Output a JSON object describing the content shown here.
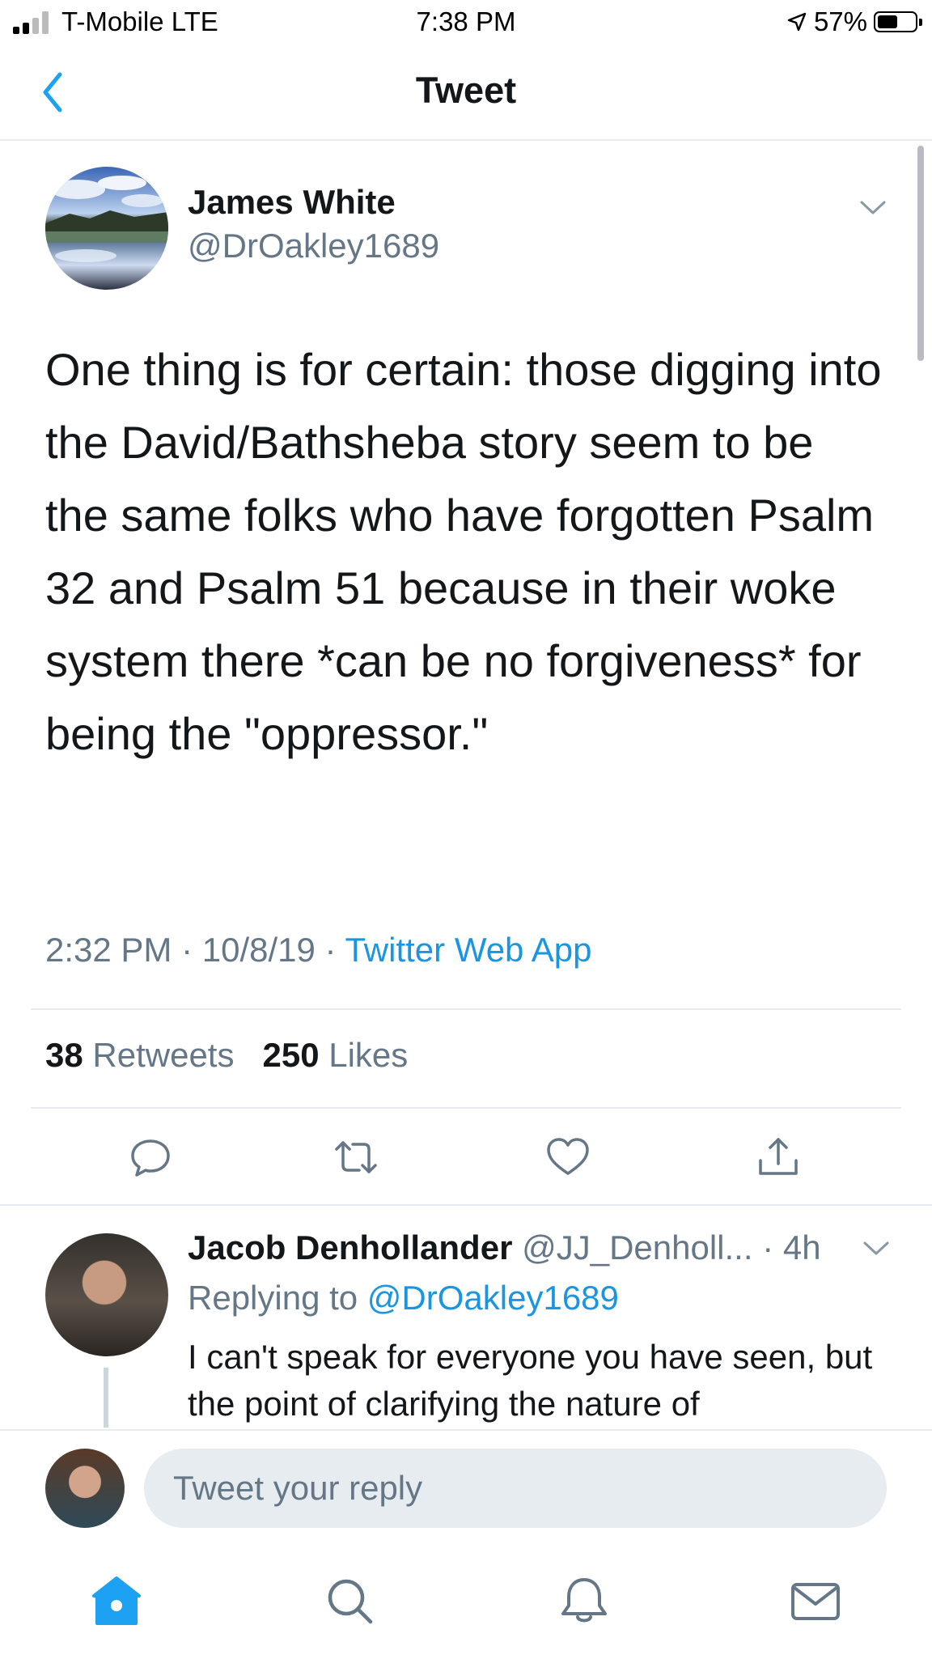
{
  "status_bar": {
    "carrier": "T-Mobile LTE",
    "time": "7:38 PM",
    "battery": "57%",
    "battery_level": 0.57
  },
  "header": {
    "title": "Tweet",
    "back_icon": "chevron-left-icon"
  },
  "tweet": {
    "author_name": "James White",
    "author_handle": "@DrOakley1689",
    "text": "One thing is for certain: those digging into the David/Bathsheba story seem to be the same folks who have forgotten Psalm 32 and Psalm 51 because in their woke system there *can be no forgiveness* for being the \"oppressor.\"",
    "time": "2:32 PM",
    "date": "10/8/19",
    "source": "Twitter Web App",
    "retweets_count": "38",
    "retweets_label": "Retweets",
    "likes_count": "250",
    "likes_label": "Likes",
    "actions": [
      "reply-icon",
      "retweet-icon",
      "like-icon",
      "share-icon"
    ]
  },
  "reply": {
    "author_name": "Jacob Denhollander",
    "author_handle": "@JJ_Denholl...",
    "age": "4h",
    "replying_prefix": "Replying to",
    "replying_to": "@DrOakley1689",
    "text": "I can't speak for everyone you have seen, but the point of clarifying the nature of"
  },
  "compose": {
    "placeholder": "Tweet your reply"
  },
  "tab_bar": {
    "items": [
      "home-icon",
      "search-icon",
      "notifications-icon",
      "messages-icon"
    ],
    "active": "home-icon"
  },
  "colors": {
    "accent": "#1b95e0",
    "secondary_text": "#657786",
    "divider": "#e6ecf0"
  }
}
